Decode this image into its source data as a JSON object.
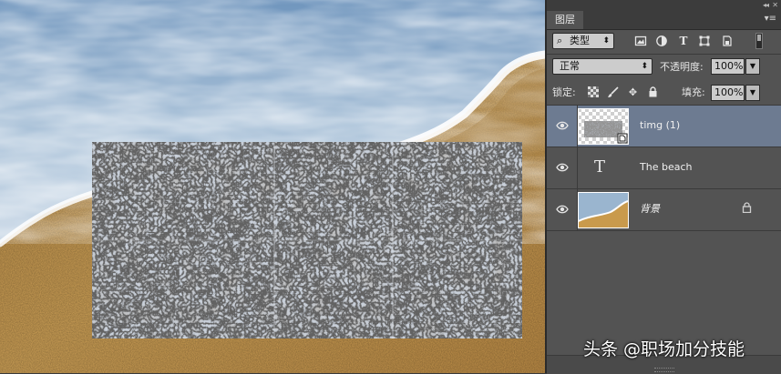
{
  "panel": {
    "tab_label": "图层",
    "filter": {
      "kind_label": "类型"
    },
    "blend_mode": "正常",
    "opacity_label": "不透明度:",
    "opacity_value": "100%",
    "lock_label": "锁定:",
    "fill_label": "填充:",
    "fill_value": "100%"
  },
  "layers": [
    {
      "name": "timg (1)",
      "selected": true,
      "visible": true,
      "type": "smart-object"
    },
    {
      "name": "The beach",
      "selected": false,
      "visible": true,
      "type": "text"
    },
    {
      "name": "背景",
      "selected": false,
      "visible": true,
      "type": "background",
      "locked": true
    }
  ],
  "watermark": "头条 @职场加分技能",
  "colors": {
    "selected_layer": "#6d7b91",
    "panel_bg": "#535353",
    "sand": "#c99a4c",
    "sea": "#7fa3c4"
  }
}
